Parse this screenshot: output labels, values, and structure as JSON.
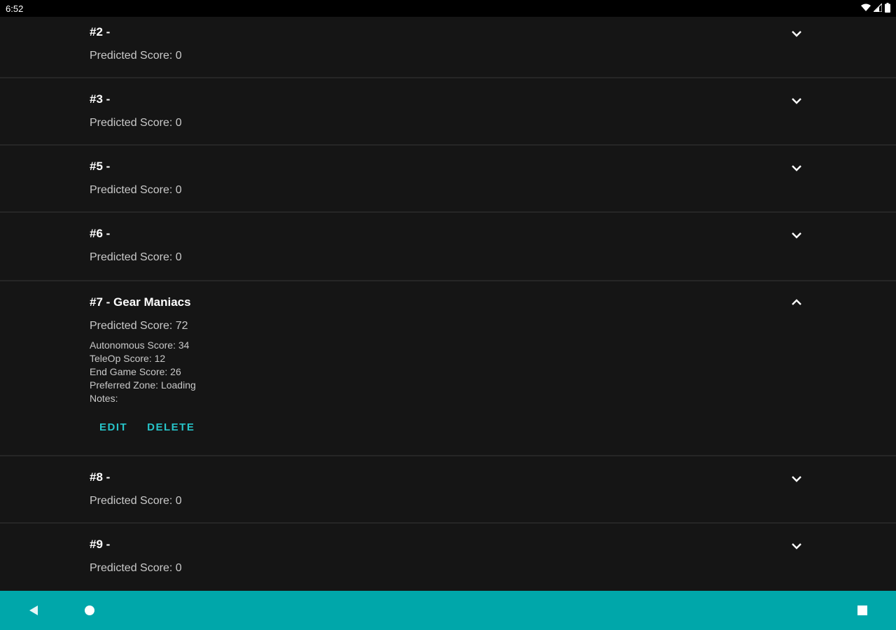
{
  "status_bar": {
    "time": "6:52",
    "icons": [
      "wifi-icon",
      "signal-icon",
      "battery-icon"
    ]
  },
  "teams": [
    {
      "title": "#2 -",
      "predicted": "Predicted Score: 0",
      "expanded": false
    },
    {
      "title": "#3 -",
      "predicted": "Predicted Score: 0",
      "expanded": false
    },
    {
      "title": "#5 -",
      "predicted": "Predicted Score: 0",
      "expanded": false
    },
    {
      "title": "#6 -",
      "predicted": "Predicted Score: 0",
      "expanded": false
    },
    {
      "title": "#7 - Gear Maniacs",
      "predicted": "Predicted Score: 72",
      "expanded": true,
      "details": {
        "autonomous": "Autonomous Score: 34",
        "teleop": "TeleOp Score: 12",
        "endgame": "End Game Score: 26",
        "zone": "Preferred Zone: Loading",
        "notes": "Notes:"
      },
      "actions": {
        "edit": "EDIT",
        "delete": "DELETE"
      }
    },
    {
      "title": "#8 -",
      "predicted": "Predicted Score: 0",
      "expanded": false
    },
    {
      "title": "#9 -",
      "predicted": "Predicted Score: 0",
      "expanded": false
    }
  ],
  "colors": {
    "background": "#121212",
    "accent": "#27c4c9",
    "nav_bar": "#00a7aa"
  },
  "nav_bar": {
    "icons": [
      "back-icon",
      "home-icon",
      "recents-icon"
    ]
  }
}
